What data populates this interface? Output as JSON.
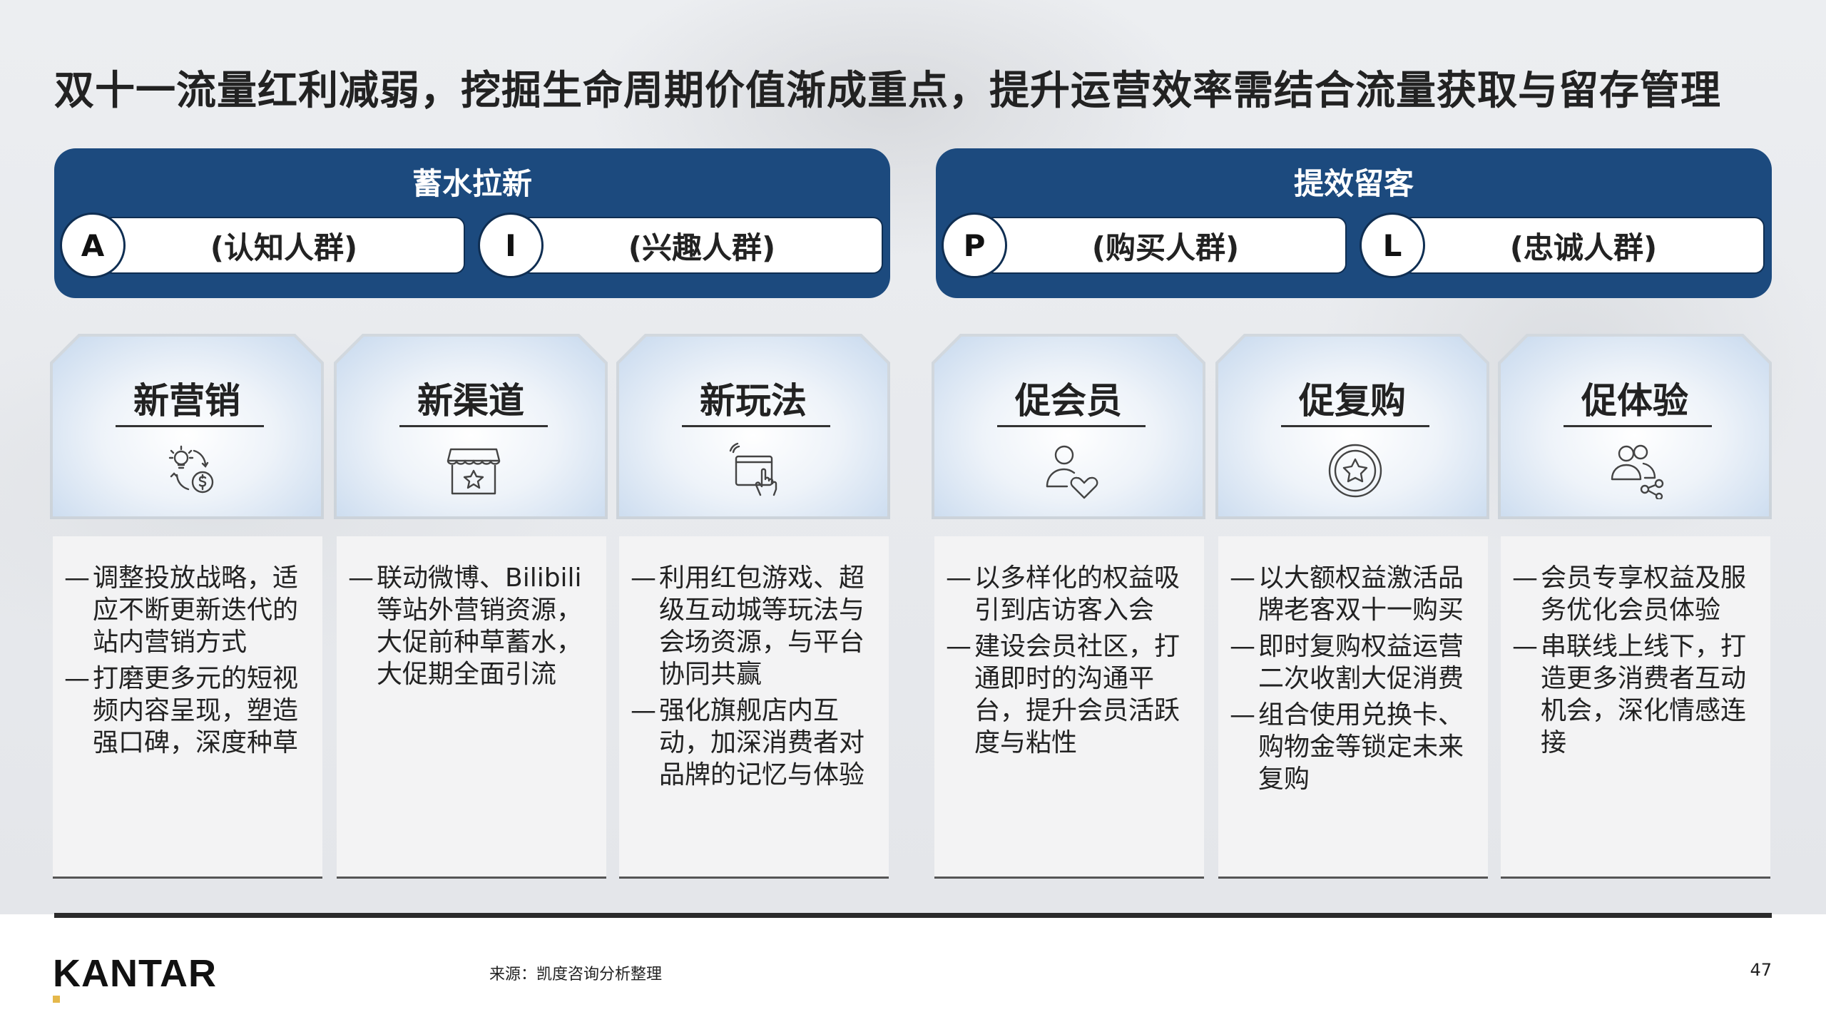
{
  "title": "双十一流量红利减弱，挖掘生命周期价值渐成重点，提升运营效率需结合流量获取与留存管理",
  "groups": [
    {
      "title": "蓄水拉新",
      "pills": [
        {
          "letter": "A",
          "label": "(认知人群)"
        },
        {
          "letter": "I",
          "label": "(兴趣人群)"
        }
      ]
    },
    {
      "title": "提效留客",
      "pills": [
        {
          "letter": "P",
          "label": "(购买人群)"
        },
        {
          "letter": "L",
          "label": "(忠诚人群)"
        }
      ]
    }
  ],
  "cards": [
    {
      "title": "新营销",
      "icon": "idea-money-icon",
      "bullets": [
        "调整投放战略，适应不断更新迭代的站内营销方式",
        "打磨更多元的短视频内容呈现，塑造强口碑，深度种草"
      ]
    },
    {
      "title": "新渠道",
      "icon": "storefront-icon",
      "bullets": [
        "联动微博、Bilibili等站外营销资源，大促前种草蓄水，大促期全面引流"
      ]
    },
    {
      "title": "新玩法",
      "icon": "screen-tap-icon",
      "bullets": [
        "利用红包游戏、超级互动城等玩法与会场资源，与平台协同共赢",
        "强化旗舰店内互动，加深消费者对品牌的记忆与体验"
      ]
    },
    {
      "title": "促会员",
      "icon": "user-heart-icon",
      "bullets": [
        "以多样化的权益吸引到店访客入会",
        "建设会员社区，打通即时的沟通平台，提升会员活跃度与粘性"
      ]
    },
    {
      "title": "促复购",
      "icon": "star-badge-icon",
      "bullets": [
        "以大额权益激活品牌老客双十一购买",
        "即时复购权益运营二次收割大促消费",
        "组合使用兑换卡、购物金等锁定未来复购"
      ]
    },
    {
      "title": "促体验",
      "icon": "users-share-icon",
      "bullets": [
        "会员专享权益及服务优化会员体验",
        "串联线上线下，打造更多消费者互动机会，深化情感连接"
      ]
    }
  ],
  "footer": {
    "logo": "KANTAR",
    "source": "来源：凯度咨询分析整理",
    "page": "47"
  },
  "colors": {
    "group_bg": "#1c4a7e",
    "accent_gold": "#e5b84b"
  }
}
